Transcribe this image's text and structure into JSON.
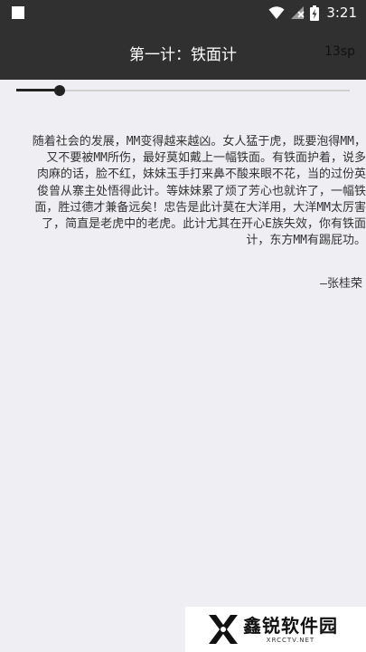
{
  "status_bar": {
    "time": "3:21",
    "icons": [
      "notification-square-icon",
      "wifi-icon",
      "no-signal-icon",
      "battery-charging-icon"
    ]
  },
  "toolbar": {
    "title": "第一计：铁面计",
    "font_size_label": "13sp"
  },
  "slider": {
    "value_fraction": 0.13
  },
  "content": {
    "text": "随着社会的发展，MM变得越来越凶。女人猛于虎，既要泡得MM，\n又不要被MM所伤，最好莫如戴上一幅铁面。有铁面护着，说多\n肉麻的话，脸不红，妹妹玉手打来鼻不酸来眼不花，当的过份英\n俊曾从寨主处悟得此计。等妹妹累了烦了芳心也就许了，一幅铁\n面，胜过德才兼备远矣！忠告是此计莫在大洋用，大洋MM太厉害\n了，简直是老虎中的老虎。此计尤其在开心E族失效，你有铁面\n计，东方MM有踢屁功。",
    "author": "—张桂荣"
  },
  "watermark": {
    "name": "鑫锐软件园",
    "url": "XRCCTV.NET"
  },
  "colors": {
    "toolbar_bg": "#303030",
    "page_bg": "#efeef3",
    "accent": "#222222"
  }
}
